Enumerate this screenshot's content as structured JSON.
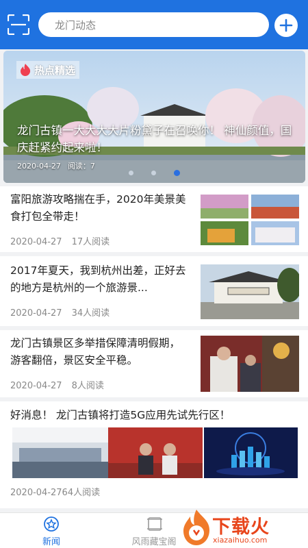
{
  "search": {
    "placeholder": "龙门动态"
  },
  "banner": {
    "tag": "热点精选",
    "title": "龙门古镇一大大大大片粉黛子在召唤你！ 神仙颜值，国庆赶紧约起来啦！",
    "date": "2020-04-27",
    "reads": "阅读：7",
    "active_dot": 3,
    "dot_count": 3
  },
  "articles": [
    {
      "title": "富阳旅游攻略揣在手，2020年美景美食打包全带走！",
      "date": "2020-04-27",
      "reads": "17人阅读"
    },
    {
      "title": "2017年夏天，我到杭州出差，正好去的地方是杭州的一个旅游景...",
      "date": "2020-04-27",
      "reads": "34人阅读"
    },
    {
      "title": "龙门古镇景区多举措保障清明假期，游客翻倍，景区安全平稳。",
      "date": "2020-04-27",
      "reads": "8人阅读"
    },
    {
      "title": "好消息！ 龙门古镇将打造5G应用先试先行区！",
      "meta": "2020-04-2764人阅读"
    }
  ],
  "nav": [
    {
      "label": "新闻",
      "icon": "star-badge-icon",
      "active": true
    },
    {
      "label": "风雨藏宝阁",
      "icon": "scroll-icon",
      "active": false
    }
  ],
  "watermark": {
    "brand": "下载火",
    "url": "xiazaihuo.com"
  },
  "colors": {
    "primary": "#1f72e0",
    "accent_red": "#e8451b",
    "meta_gray": "#888888"
  }
}
